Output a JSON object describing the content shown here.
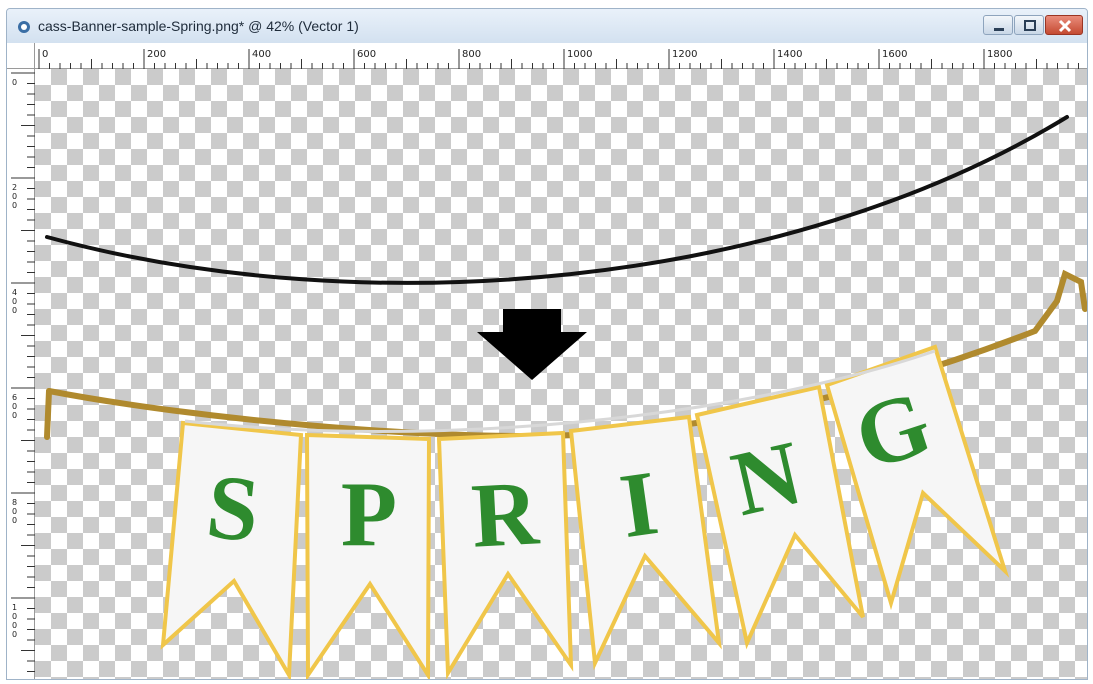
{
  "window": {
    "title": "cass-Banner-sample-Spring.png* @  42% (Vector 1)",
    "buttons": [
      "minimize-icon",
      "maximize-icon",
      "close-icon"
    ]
  },
  "ruler": {
    "horizontal_labels": [
      "0",
      "200",
      "400",
      "600",
      "800",
      "1000",
      "1200",
      "1400",
      "1600",
      "1800"
    ],
    "vertical_labels": [
      "0",
      "200",
      "400",
      "600",
      "800",
      "1000"
    ]
  },
  "canvas": {
    "background": "transparency-checkerboard",
    "arrow_icon": "down-arrow-icon",
    "banner_letters": [
      "S",
      "P",
      "R",
      "I",
      "N",
      "G"
    ],
    "colors": {
      "letter": "#2e8b2e",
      "flag_fill": "#f6f6f6",
      "flag_border": "#f0c64a",
      "rope": "#b08a2e",
      "curve": "#111111"
    }
  }
}
